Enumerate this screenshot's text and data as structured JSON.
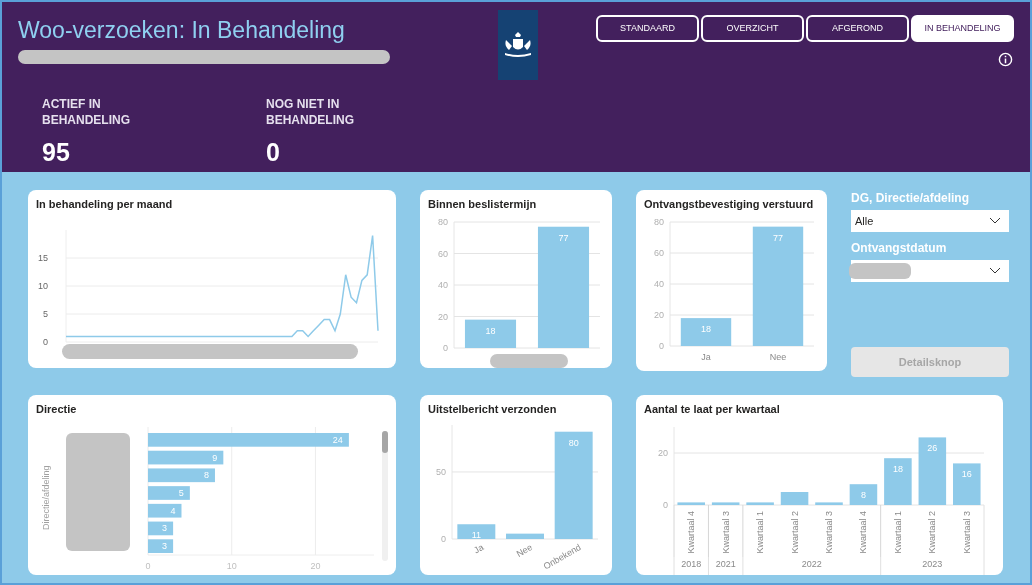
{
  "header": {
    "title": "Woo-verzoeken: In Behandeling",
    "tabs": [
      {
        "label": "STANDAARD",
        "selected": false
      },
      {
        "label": "OVERZICHT",
        "selected": false
      },
      {
        "label": "AFGEROND",
        "selected": false
      },
      {
        "label": "IN BEHANDELING",
        "selected": true
      }
    ]
  },
  "kpis": [
    {
      "label": "ACTIEF IN BEHANDELING",
      "value": "95"
    },
    {
      "label": "NOG NIET IN BEHANDELING",
      "value": "0"
    }
  ],
  "per_month": {
    "title": "In behandeling per maand",
    "chart_data": {
      "type": "line",
      "grid": true,
      "ylim": [
        0,
        20
      ],
      "yticks": [
        0,
        5,
        10,
        15
      ],
      "series": [
        {
          "color": "#8ecae9",
          "values": [
            1,
            1,
            1,
            1,
            1,
            1,
            1,
            1,
            1,
            1,
            1,
            1,
            1,
            1,
            1,
            1,
            1,
            1,
            1,
            1,
            1,
            1,
            1,
            1,
            1,
            1,
            1,
            1,
            1,
            1,
            1,
            1,
            1,
            1,
            1,
            1,
            1,
            1,
            1,
            1,
            1,
            1,
            1,
            2,
            2,
            1,
            2,
            3,
            4,
            4,
            2,
            5,
            12,
            8,
            7,
            11,
            12,
            19,
            2
          ]
        }
      ]
    }
  },
  "within_term": {
    "title": "Binnen beslistermijn",
    "chart_data": {
      "type": "bar",
      "grid": true,
      "ylim": [
        0,
        80
      ],
      "yticks": [
        0,
        20,
        40,
        60,
        80
      ],
      "values": [
        18,
        77
      ],
      "value_labels": [
        "18",
        "77"
      ]
    }
  },
  "receipt": {
    "title": "Ontvangstbevestiging verstuurd",
    "chart_data": {
      "type": "bar",
      "grid": true,
      "ylim": [
        0,
        80
      ],
      "yticks": [
        0,
        20,
        40,
        60,
        80
      ],
      "categories": [
        "Ja",
        "Nee"
      ],
      "values": [
        18,
        77
      ],
      "value_labels": [
        "18",
        "77"
      ]
    }
  },
  "filters": [
    {
      "label": "DG, Directie/afdeling",
      "value": "Alle"
    },
    {
      "label": "Ontvangstdatum"
    }
  ],
  "detail_button": {
    "label": "Detailsknop",
    "disabled": true
  },
  "directie": {
    "title": "Directie",
    "chart_data": {
      "type": "bar",
      "orientation": "horizontal",
      "grid": true,
      "ylabel": "Directie/afdeling",
      "xlim": [
        0,
        27
      ],
      "xticks": [
        0,
        10,
        20
      ],
      "values": [
        24,
        9,
        8,
        5,
        4,
        3,
        3
      ],
      "value_labels": [
        "24",
        "9",
        "8",
        "5",
        "4",
        "3",
        "3"
      ]
    }
  },
  "postponement": {
    "title": "Uitstelbericht verzonden",
    "chart_data": {
      "type": "bar",
      "grid": true,
      "ylim": [
        0,
        85
      ],
      "yticks": [
        0,
        50
      ],
      "categories": [
        "Ja",
        "Nee",
        "Onbekend"
      ],
      "values": [
        11,
        4,
        80
      ],
      "value_labels": [
        "11",
        null,
        "80"
      ]
    }
  },
  "late_per_quarter": {
    "title": "Aantal te laat per kwartaal",
    "chart_data": {
      "type": "bar",
      "grid": true,
      "ylim": [
        0,
        30
      ],
      "yticks": [
        0,
        20
      ],
      "categories": [
        "Kwartaal 4",
        "Kwartaal 3",
        "Kwartaal 1",
        "Kwartaal 2",
        "Kwartaal 3",
        "Kwartaal 4",
        "Kwartaal 1",
        "Kwartaal 2",
        "Kwartaal 3"
      ],
      "annotations": [
        "2018",
        "2021",
        "2022",
        "2023"
      ],
      "values": [
        1,
        1,
        1,
        5,
        1,
        8,
        18,
        26,
        16
      ],
      "value_labels": [
        null,
        null,
        null,
        null,
        null,
        "8",
        "18",
        "26",
        "16"
      ]
    },
    "year_starts": [
      true,
      true,
      true,
      false,
      false,
      false,
      true,
      false,
      false
    ]
  }
}
